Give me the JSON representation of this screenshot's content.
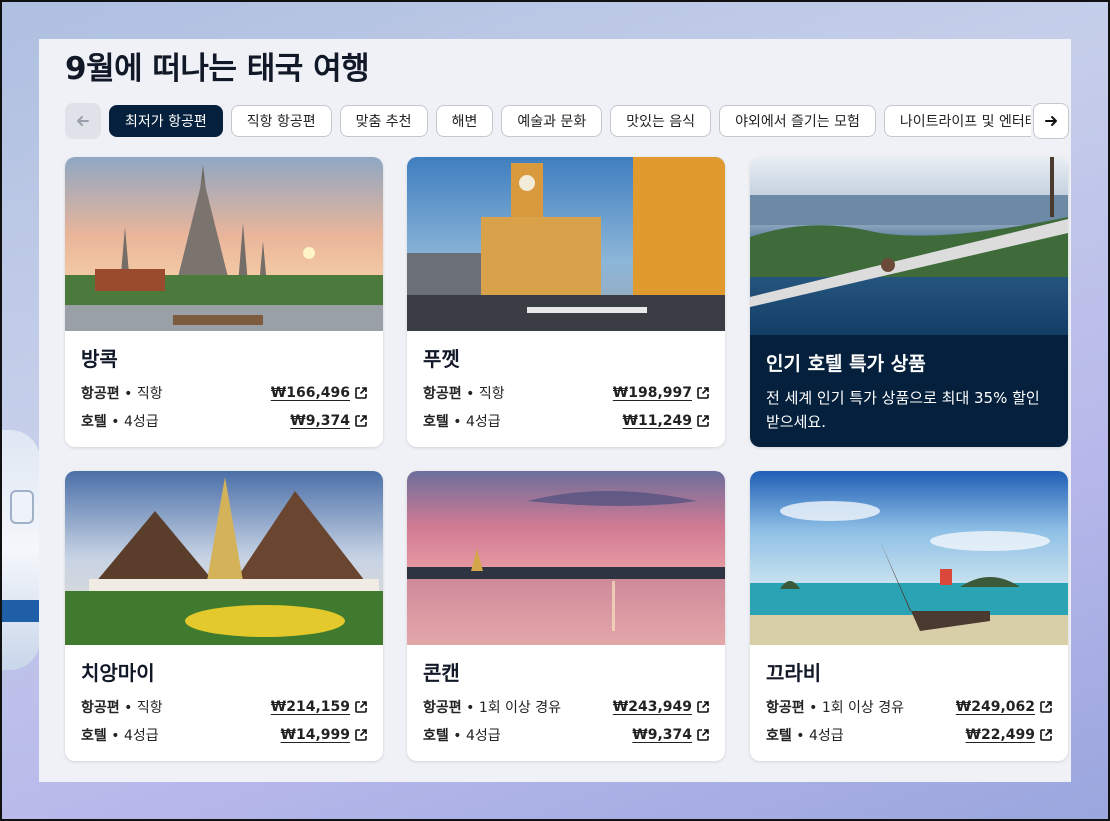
{
  "page": {
    "title": "9월에 떠나는 태국 여행"
  },
  "nav": {
    "prev_icon": "arrow-left-icon",
    "next_icon": "arrow-right-icon"
  },
  "tabs": [
    {
      "label": "최저가 항공편",
      "active": true
    },
    {
      "label": "직항 항공편"
    },
    {
      "label": "맞춤 추천"
    },
    {
      "label": "해변"
    },
    {
      "label": "예술과 문화"
    },
    {
      "label": "맛있는 음식"
    },
    {
      "label": "야외에서 즐기는 모험"
    },
    {
      "label": "나이트라이프 및 엔터테인먼트"
    }
  ],
  "cards": [
    {
      "city": "방콕",
      "flight_label": "항공편",
      "flight_detail": "직항",
      "flight_price": "₩166,496",
      "hotel_label": "호텔",
      "hotel_detail": "4성급",
      "hotel_price": "₩9,374"
    },
    {
      "city": "푸껫",
      "flight_label": "항공편",
      "flight_detail": "직항",
      "flight_price": "₩198,997",
      "hotel_label": "호텔",
      "hotel_detail": "4성급",
      "hotel_price": "₩11,249"
    },
    {
      "city": "치앙마이",
      "flight_label": "항공편",
      "flight_detail": "직항",
      "flight_price": "₩214,159",
      "hotel_label": "호텔",
      "hotel_detail": "4성급",
      "hotel_price": "₩14,999"
    },
    {
      "city": "콘캔",
      "flight_label": "항공편",
      "flight_detail": "1회 이상 경유",
      "flight_price": "₩243,949",
      "hotel_label": "호텔",
      "hotel_detail": "4성급",
      "hotel_price": "₩9,374"
    },
    {
      "city": "끄라비",
      "flight_label": "항공편",
      "flight_detail": "1회 이상 경유",
      "flight_price": "₩249,062",
      "hotel_label": "호텔",
      "hotel_detail": "4성급",
      "hotel_price": "₩22,499"
    }
  ],
  "promo": {
    "title": "인기 호텔 특가 상품",
    "text": "전 세계 인기 특가 상품으로 최대 35% 할인받으세요."
  },
  "colors": {
    "accent": "#05203c",
    "panel": "#eff1f6"
  }
}
